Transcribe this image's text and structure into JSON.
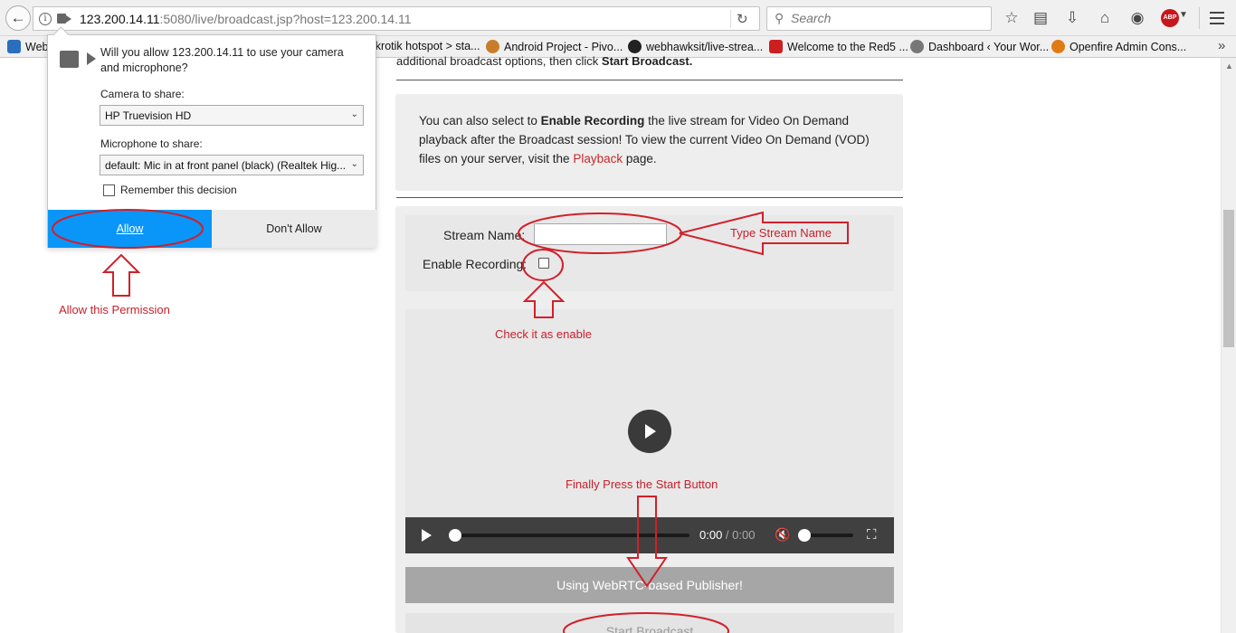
{
  "browser": {
    "url_host": "123.200.14.11",
    "url_rest": ":5080/live/broadcast.jsp?host=123.200.14.11",
    "search_placeholder": "Search",
    "abp_label": "ABP"
  },
  "bookmarks": [
    {
      "label": "Web",
      "color": "#2a6fbd"
    },
    {
      "label": "ikrotik hotspot > sta...",
      "color": "#f0f0f0"
    },
    {
      "label": "Android Project - Pivo...",
      "color": "#c97d2a"
    },
    {
      "label": "webhawksit/live-strea...",
      "color": "#222222"
    },
    {
      "label": "Welcome to the Red5 ...",
      "color": "#cc1f1f"
    },
    {
      "label": "Dashboard ‹ Your Wor...",
      "color": "#777777"
    },
    {
      "label": "Openfire Admin Cons...",
      "color": "#e07b14"
    }
  ],
  "page": {
    "intro_text": "additional broadcast options, then click ",
    "intro_bold": "Start Broadcast.",
    "info_1": "You can also select to ",
    "info_bold": "Enable Recording",
    "info_2": " the live stream for Video On Demand playback after the Broadcast session! To view the current Video On Demand (VOD) files on your server, visit the ",
    "info_link": "Playback",
    "info_3": " page.",
    "stream_name_label": "Stream Name:",
    "enable_recording_label": "Enable Recording:",
    "time_current": "0:00",
    "time_sep": " / ",
    "time_duration": "0:00",
    "publisher_text": "Using WebRTC-based Publisher!",
    "start_button": "Start Broadcast"
  },
  "permission_popup": {
    "question": "Will you allow 123.200.14.11 to use your camera and microphone?",
    "camera_label": "Camera to share:",
    "camera_value": "HP Truevision HD",
    "mic_label": "Microphone to share:",
    "mic_value": "default: Mic in at front panel (black) (Realtek Hig...",
    "remember_label": "Remember this decision",
    "allow_label": "Allow",
    "deny_label": "Don't Allow"
  },
  "annotations": {
    "allow_permission": "Allow this Permission",
    "type_stream_name": "Type Stream Name",
    "check_enable": "Check it as enable",
    "press_start": "Finally Press the Start Button",
    "color": "#c8202b"
  },
  "colors": {
    "allow_blue": "#0996f8",
    "link_red": "#c62828",
    "annotation_red": "#c8202b"
  }
}
